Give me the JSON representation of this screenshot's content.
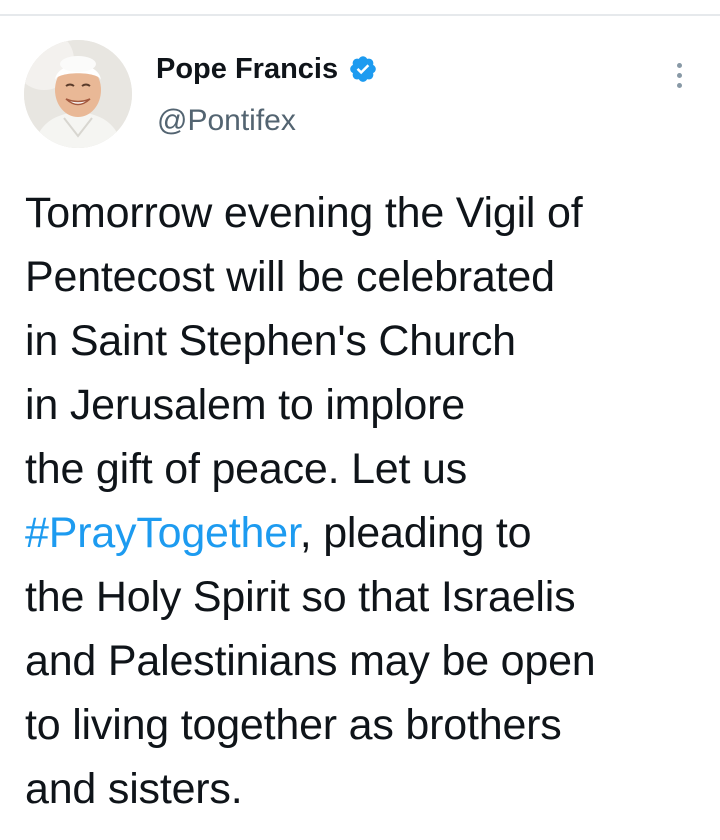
{
  "author": {
    "name": "Pope Francis",
    "handle": "@Pontifex",
    "verified": true,
    "avatar_icon": "user-avatar-photo"
  },
  "actions": {
    "more_icon": "more-vertical-icon"
  },
  "tweet": {
    "lines": [
      "Tomorrow evening the Vigil of",
      "Pentecost will be celebrated",
      "in Saint Stephen's Church",
      "in Jerusalem to implore",
      "the gift of peace. Let us",
      "",
      "the Holy Spirit so that Israelis",
      "and Palestinians may be open",
      "to living together as brothers",
      "and sisters."
    ],
    "hashtag": "#PrayTogether",
    "hashtag_after": ", pleading to"
  },
  "colors": {
    "text": "#0f1419",
    "secondary": "#536471",
    "link": "#1d9bf0",
    "verified_badge": "#1d9bf0"
  }
}
